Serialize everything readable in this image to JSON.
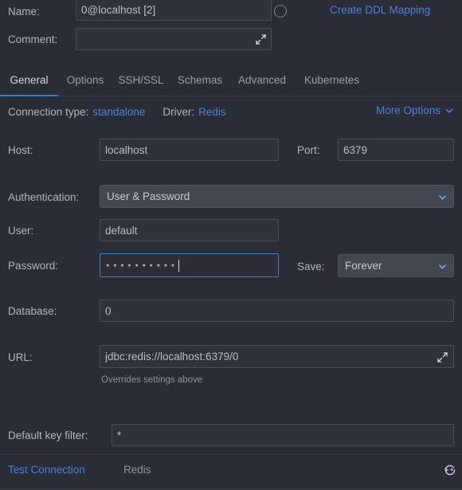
{
  "window": {
    "theme_bg": "#2b2d36",
    "accent": "#4d80d4",
    "field_bg": "#2f323b",
    "combo_bg": "#43474f",
    "focus_border": "#4a7ebb"
  },
  "header": {
    "name_label": "Name:",
    "name_value": "0@localhost [2]",
    "name_toggle_icon": "circle-icon",
    "ddl_link": "Create DDL Mapping",
    "comment_label": "Comment:",
    "comment_value": "",
    "comment_placeholder": "",
    "comment_expand_icon": "expand-diagonal-icon"
  },
  "tabs": [
    {
      "label": "General",
      "active": true
    },
    {
      "label": "Options",
      "active": false
    },
    {
      "label": "SSH/SSL",
      "active": false
    },
    {
      "label": "Schemas",
      "active": false
    },
    {
      "label": "Advanced",
      "active": false
    },
    {
      "label": "Kubernetes",
      "active": false
    }
  ],
  "meta_bar": {
    "connection_type_label": "Connection type:",
    "connection_type_value": "standalone",
    "driver_label": "Driver:",
    "driver_value": "Redis",
    "more_options": "More Options",
    "more_options_icon": "chevron-down-icon"
  },
  "form": {
    "host_label": "Host:",
    "host_value": "localhost",
    "port_label": "Port:",
    "port_value": "6379",
    "auth_label": "Authentication:",
    "auth_value": "User & Password",
    "auth_icon": "chevron-down-icon",
    "user_label": "User:",
    "user_value": "default",
    "password_label": "Password:",
    "password_value": "••••••••••",
    "password_char_count": 10,
    "save_label": "Save:",
    "save_value": "Forever",
    "save_icon": "chevron-down-icon",
    "database_label": "Database:",
    "database_value": "0",
    "url_label": "URL:",
    "url_value": "jdbc:redis://localhost:6379/0",
    "url_expand_icon": "expand-diagonal-icon",
    "url_hint": "Overrides settings above",
    "key_filter_label": "Default key filter:",
    "key_filter_value": "*"
  },
  "bottom_bar": {
    "test_connection": "Test Connection",
    "driver_status": "Redis",
    "reset_icon": "revert-circular-arrow-icon"
  }
}
